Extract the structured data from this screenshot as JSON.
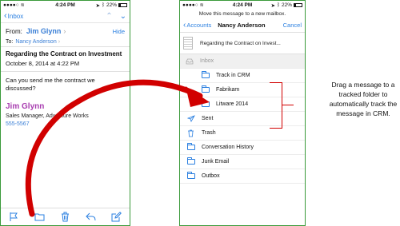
{
  "left_phone": {
    "status": {
      "carrier": "●●●●○",
      "wifi_icon": "wifi-icon",
      "time": "4:24 PM",
      "battery_text": "22%",
      "battery_level": 0.22
    },
    "nav": {
      "back_label": "Inbox"
    },
    "header": {
      "from_label": "From:",
      "from_name": "Jim Glynn",
      "hide_label": "Hide",
      "to_label": "To:",
      "to_name": "Nancy Anderson"
    },
    "subject": "Regarding the Contract on Investment",
    "date": "October 8, 2014 at 4:22 PM",
    "body": "Can you send me the contract we discussed?",
    "signature": {
      "name": "Jim Glynn",
      "title": "Sales Manager, Adventure Works",
      "phone": "555-5567"
    },
    "toolbar_icons": [
      "flag-icon",
      "folder-icon",
      "trash-icon",
      "reply-icon",
      "compose-icon"
    ]
  },
  "right_phone": {
    "status": {
      "carrier": "●●●●○",
      "wifi_icon": "wifi-icon",
      "time": "4:24 PM",
      "battery_text": "22%",
      "battery_level": 0.22
    },
    "move_message": "Move this message to a new mailbox.",
    "nav": {
      "back_label": "Accounts",
      "title": "Nancy Anderson",
      "cancel_label": "Cancel"
    },
    "message_subject": "Regarding the Contract on Invest...",
    "folders": {
      "inbox": "Inbox",
      "track_in_crm": "Track in CRM",
      "fabrikam": "Fabrikam",
      "litware": "Litware 2014",
      "sent": "Sent",
      "trash": "Trash",
      "conversation_history": "Conversation History",
      "junk_email": "Junk Email",
      "outbox": "Outbox"
    }
  },
  "annotation": {
    "text": "Drag a message to a tracked folder to automatically track the message in CRM."
  },
  "colors": {
    "ios_blue": "#2a7fe0",
    "signature_purple": "#a83db0",
    "arrow_red": "#d10000",
    "frame_green": "#3a9a3a"
  }
}
